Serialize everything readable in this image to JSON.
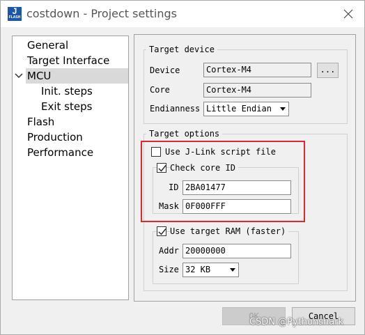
{
  "window": {
    "title": "costdown - Project settings",
    "icon_letter": "J",
    "icon_sub": "FLASH"
  },
  "tree": {
    "items": [
      {
        "label": "General"
      },
      {
        "label": "Target Interface"
      },
      {
        "label": "MCU"
      },
      {
        "label": "Init. steps"
      },
      {
        "label": "Exit steps"
      },
      {
        "label": "Flash"
      },
      {
        "label": "Production"
      },
      {
        "label": "Performance"
      }
    ],
    "selected": "MCU"
  },
  "target_device": {
    "legend": "Target device",
    "device_label": "Device",
    "device_value": "Cortex-M4",
    "browse_label": "...",
    "core_label": "Core",
    "core_value": "Cortex-M4",
    "endianness_label": "Endianness",
    "endianness_value": "Little Endian"
  },
  "target_options": {
    "legend": "Target options",
    "use_script_label": "Use J-Link script file",
    "use_script_checked": false,
    "check_core_label": "Check core ID",
    "check_core_checked": true,
    "id_label": "ID",
    "id_value": "2BA01477",
    "mask_label": "Mask",
    "mask_value": "0F000FFF",
    "use_ram_label": "Use target RAM (faster)",
    "use_ram_checked": true,
    "addr_label": "Addr",
    "addr_value": "20000000",
    "size_label": "Size",
    "size_value": "32 KB"
  },
  "buttons": {
    "ok": "OK",
    "cancel": "Cancel"
  },
  "watermark": "CSDN @Pythonshark",
  "colors": {
    "highlight_box": "#e0282c",
    "icon_bg": "#1b57a8"
  }
}
